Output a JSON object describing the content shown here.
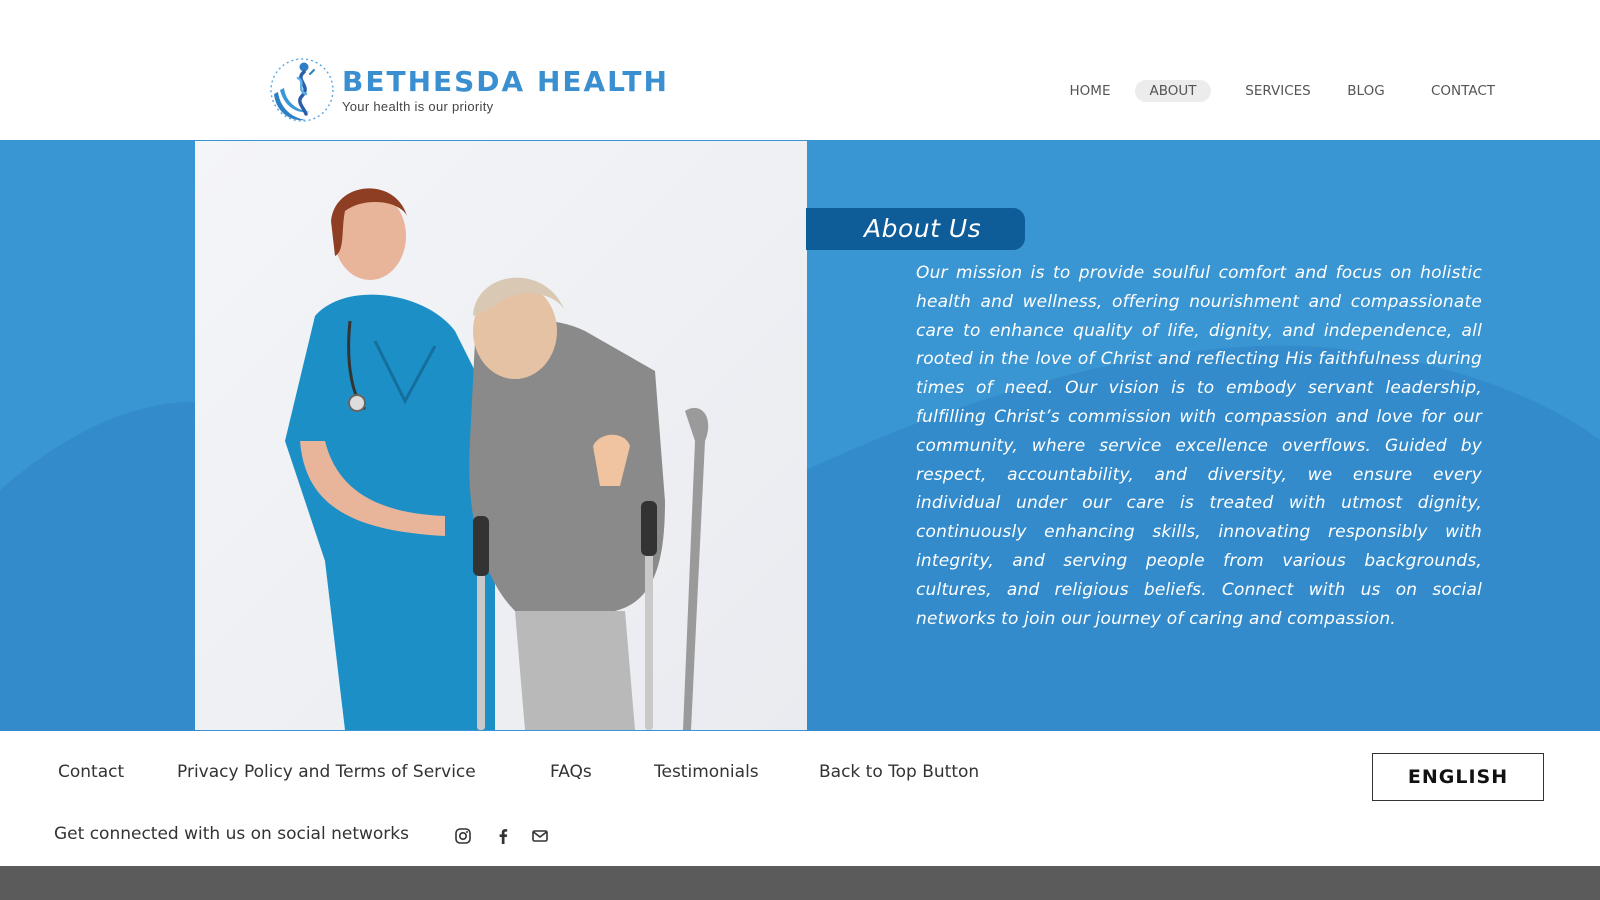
{
  "brand": {
    "name": "BETHESDA HEALTH",
    "tagline": "Your health is our priority",
    "icon": "caduceus-person-logo-icon"
  },
  "nav": {
    "items": [
      {
        "label": "HOME",
        "active": false
      },
      {
        "label": "ABOUT",
        "active": true
      },
      {
        "label": "SERVICES",
        "active": false
      },
      {
        "label": "BLOG",
        "active": false
      },
      {
        "label": "CONTACT",
        "active": false
      }
    ]
  },
  "hero": {
    "image_subject": "nurse assisting elderly woman with crutches",
    "about_title": "About Us",
    "about_text": "Our mission is to provide soulful comfort and focus on holistic health and wellness, offering nourishment and compassionate care to enhance quality of life, dignity, and independence, all rooted in the love of Christ and reflecting His faithfulness during times of need. Our vision is to embody servant leadership, fulfilling Christ’s commission with compassion and love for our community, where service excellence overflows. Guided by respect, accountability, and diversity, we ensure every individual under our care is treated with utmost dignity, continuously enhancing skills, innovating responsibly with integrity, and serving people from various backgrounds, cultures, and religious beliefs. Connect with us on social networks to join our journey of caring and compassion."
  },
  "footer": {
    "links": [
      {
        "label": "Contact"
      },
      {
        "label": "Privacy Policy and Terms of Service"
      },
      {
        "label": "FAQs"
      },
      {
        "label": "Testimonials"
      },
      {
        "label": "Back to Top Button"
      }
    ],
    "language_button": "ENGLISH",
    "social_label": "Get connected with us on social networks",
    "social_icons": [
      "instagram-icon",
      "facebook-icon",
      "mail-icon"
    ]
  },
  "colors": {
    "brand_blue": "#3a8fd0",
    "hero_background": "#3a95d3",
    "about_pill": "#0e5d99",
    "bottom_bar": "#5b5b5b"
  }
}
